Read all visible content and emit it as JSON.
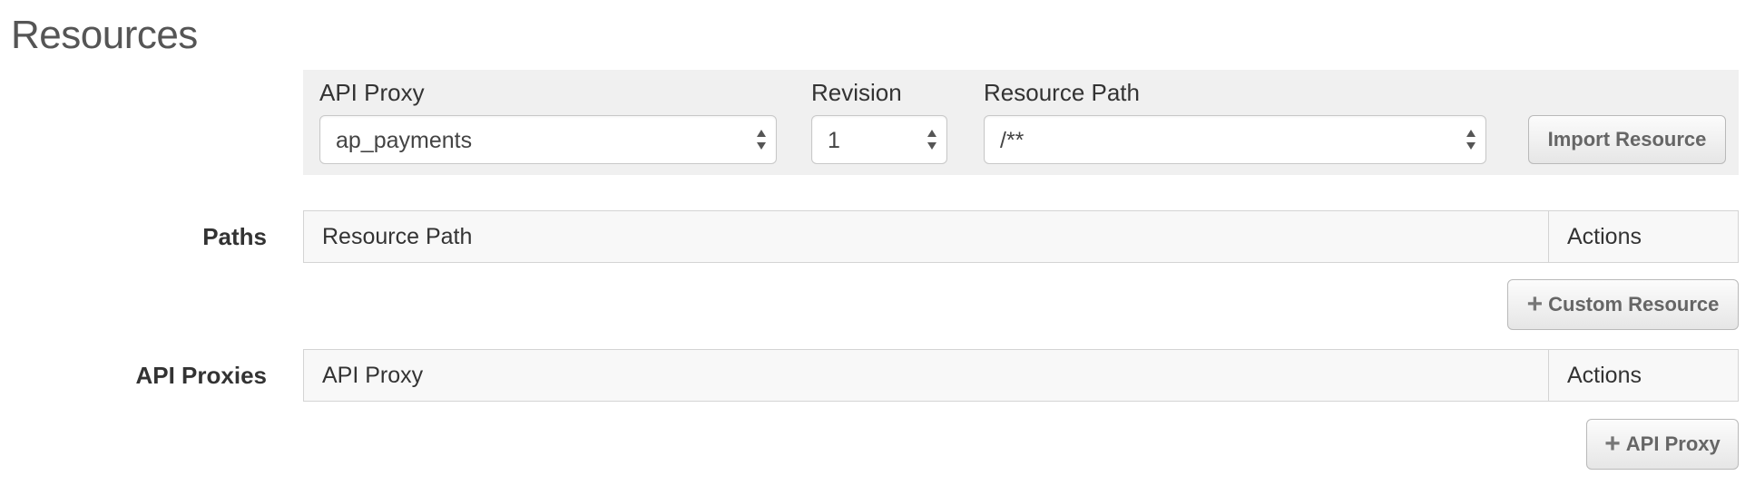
{
  "page": {
    "title": "Resources"
  },
  "filters": {
    "api_proxy": {
      "label": "API Proxy",
      "value": "ap_payments"
    },
    "revision": {
      "label": "Revision",
      "value": "1"
    },
    "resource_path": {
      "label": "Resource Path",
      "value": "/**"
    },
    "import_button": "Import Resource"
  },
  "paths": {
    "label": "Paths",
    "columns": [
      "Resource Path",
      "Actions"
    ],
    "rows": [],
    "add_button": "Custom Resource"
  },
  "api_proxies": {
    "label": "API Proxies",
    "columns": [
      "API Proxy",
      "Actions"
    ],
    "rows": [],
    "add_button": "API Proxy"
  },
  "icons": {
    "stepper": "up-down-stepper-icon",
    "plus": "plus-icon"
  }
}
